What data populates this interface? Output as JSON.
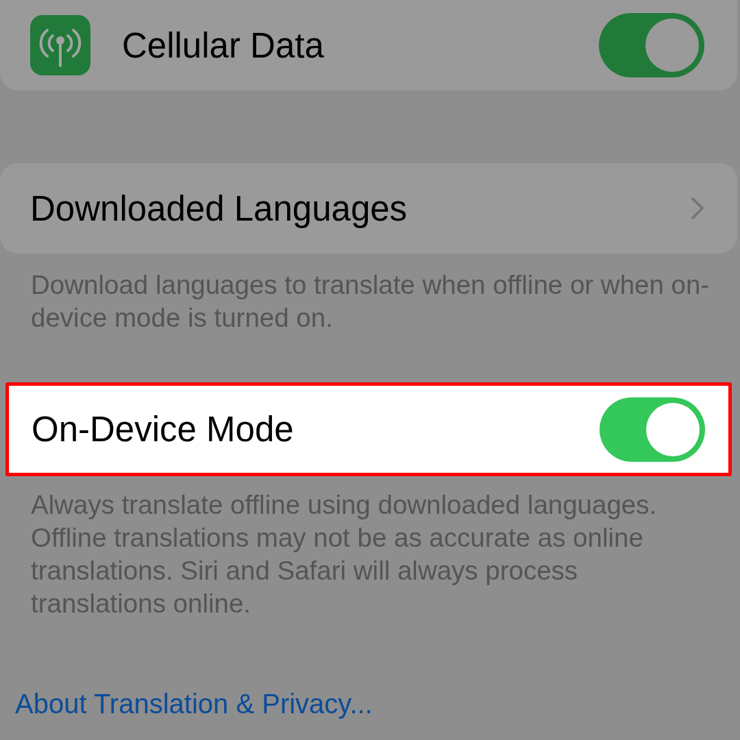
{
  "groups": [
    {
      "kind": "app_switch",
      "label": "Cellular Data",
      "on": true,
      "highlighted": false
    },
    {
      "kind": "link",
      "label": "Downloaded Languages",
      "highlighted": false,
      "footer": "Download languages to translate when offline or when on-device mode is turned on."
    },
    {
      "kind": "switch",
      "label": "On-Device Mode",
      "on": true,
      "highlighted": true,
      "footer": "Always translate offline using downloaded languages. Offline translations may not be as accurate as online translations. Siri and Safari will always process translations online."
    }
  ],
  "about_link": "About Translation & Privacy..."
}
